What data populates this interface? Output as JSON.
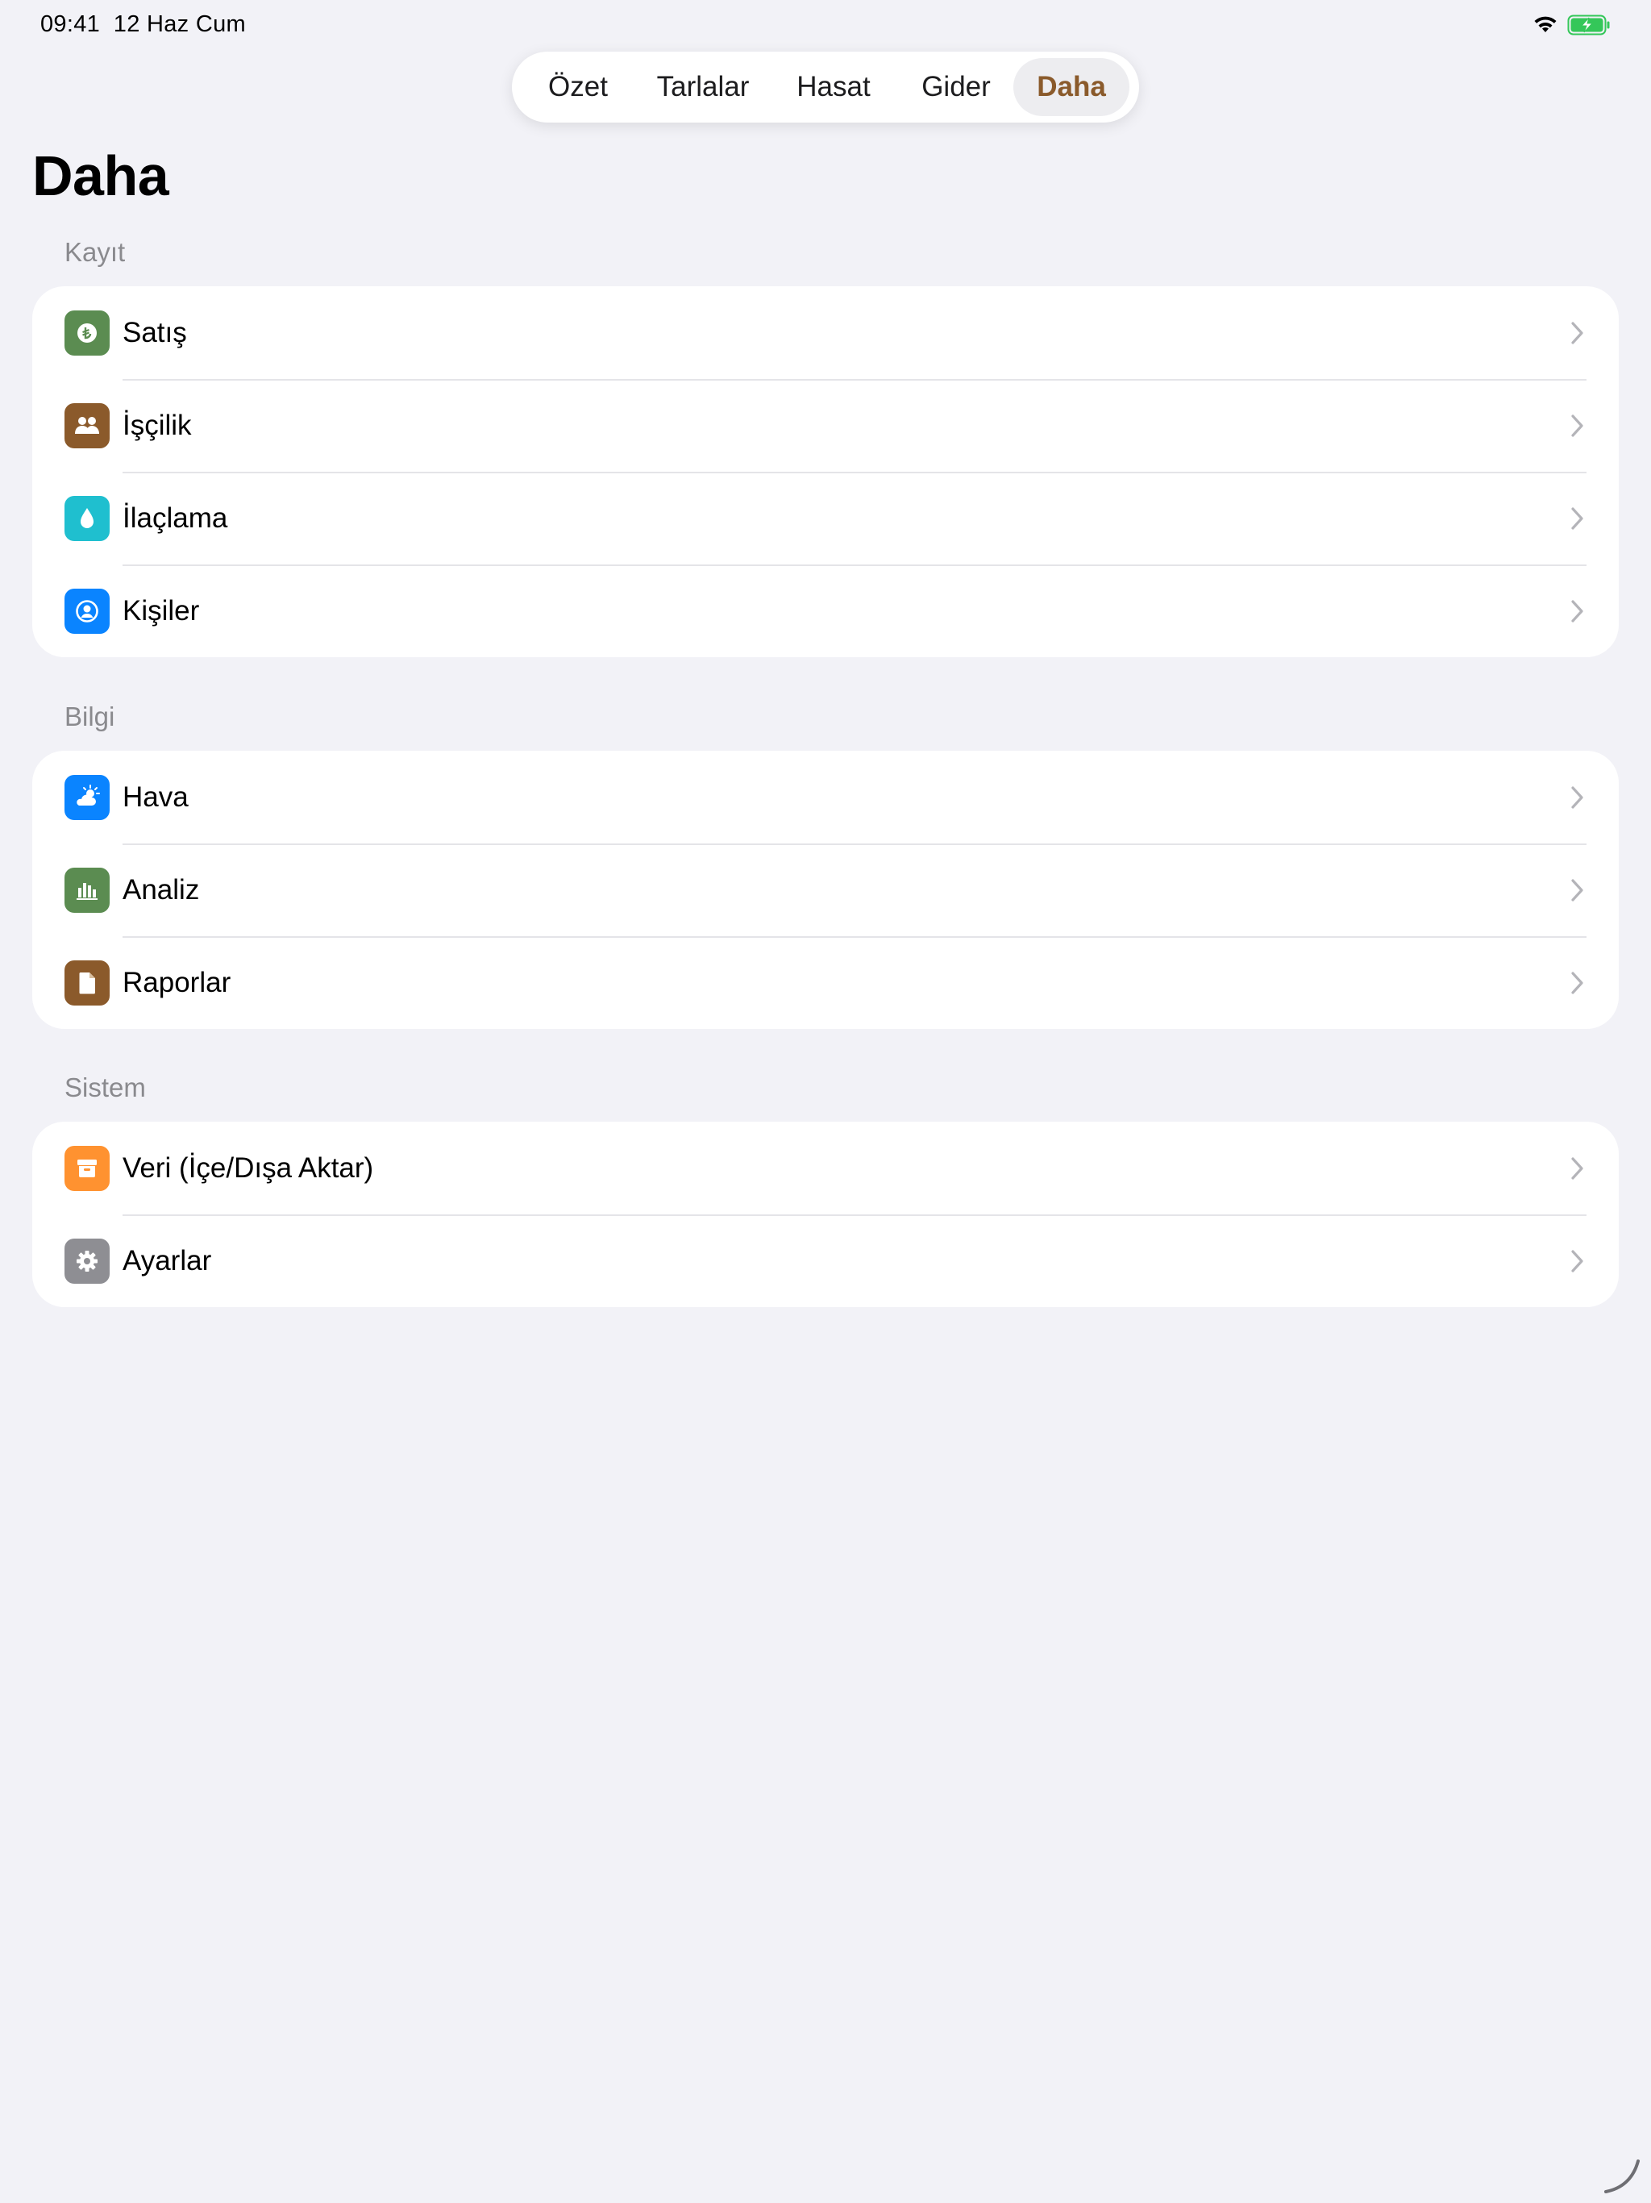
{
  "status_bar": {
    "time": "09:41",
    "date": "12 Haz Cum"
  },
  "tabs": [
    {
      "label": "Özet",
      "active": false
    },
    {
      "label": "Tarlalar",
      "active": false
    },
    {
      "label": "Hasat",
      "active": false
    },
    {
      "label": "Gider",
      "active": false
    },
    {
      "label": "Daha",
      "active": true
    }
  ],
  "title": "Daha",
  "sections": [
    {
      "header": "Kayıt",
      "items": [
        {
          "label": "Satış",
          "icon": "lira-circle-icon",
          "color": "#5b8c51"
        },
        {
          "label": "İşçilik",
          "icon": "people-icon",
          "color": "#8b5a2b"
        },
        {
          "label": "İlaçlama",
          "icon": "drop-icon",
          "color": "#1fbfcf"
        },
        {
          "label": "Kişiler",
          "icon": "person-circle-icon",
          "color": "#0a84ff"
        }
      ]
    },
    {
      "header": "Bilgi",
      "items": [
        {
          "label": "Hava",
          "icon": "cloud-sun-icon",
          "color": "#0a84ff"
        },
        {
          "label": "Analiz",
          "icon": "bar-chart-icon",
          "color": "#5b8c51"
        },
        {
          "label": "Raporlar",
          "icon": "document-icon",
          "color": "#8b5a2b"
        }
      ]
    },
    {
      "header": "Sistem",
      "items": [
        {
          "label": "Veri (İçe/Dışa Aktar)",
          "icon": "archive-box-icon",
          "color": "#ff9230"
        },
        {
          "label": "Ayarlar",
          "icon": "gear-icon",
          "color": "#8e8e93"
        }
      ]
    }
  ],
  "colors": {
    "accent": "#8a5a2b",
    "background": "#f2f2f7",
    "battery": "#34c759"
  }
}
